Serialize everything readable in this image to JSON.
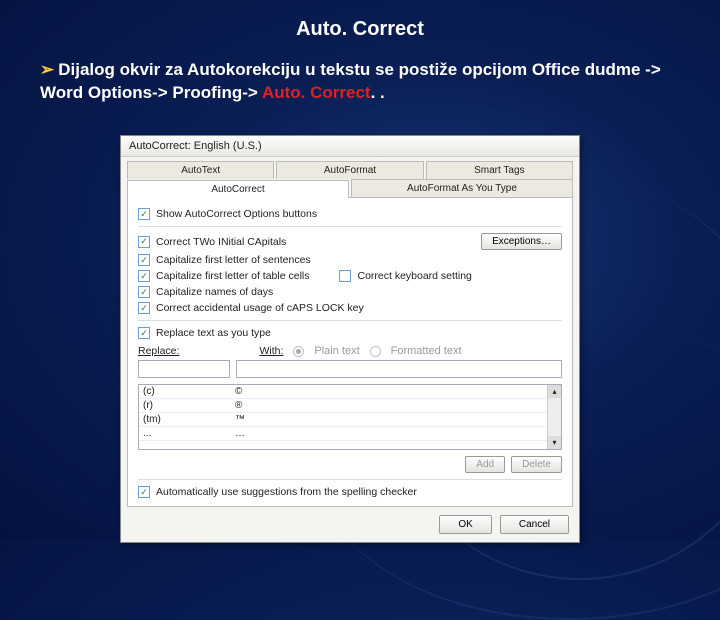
{
  "slide": {
    "title": "Auto. Correct",
    "desc_pre": "Dijalog okvir za Autokorekciju u tekstu se postiže opcijom Office dudme -> Word Options-> Proofing-> ",
    "desc_hl": "Auto. Correct",
    "desc_post": ". ."
  },
  "dialog": {
    "title": "AutoCorrect: English (U.S.)",
    "tabs_top": [
      "AutoText",
      "AutoFormat",
      "Smart Tags"
    ],
    "tabs_bottom": [
      "AutoCorrect",
      "AutoFormat As You Type"
    ],
    "opts": {
      "show_buttons": "Show AutoCorrect Options buttons",
      "two_initial": "Correct TWo INitial CApitals",
      "first_sentence": "Capitalize first letter of sentences",
      "first_cell": "Capitalize first letter of table cells",
      "correct_keyb": "Correct keyboard setting",
      "days": "Capitalize names of days",
      "caps_lock": "Correct accidental usage of cAPS LOCK key",
      "replace": "Replace text as you type"
    },
    "exceptions_btn": "Exceptions…",
    "replace_label": "Replace:",
    "with_label": "With:",
    "radio_plain": "Plain text",
    "radio_formatted": "Formatted text",
    "table_rows": [
      {
        "r": "(c)",
        "w": "©"
      },
      {
        "r": "(r)",
        "w": "®"
      },
      {
        "r": "(tm)",
        "w": "™"
      },
      {
        "r": "...",
        "w": "…"
      }
    ],
    "add_btn": "Add",
    "delete_btn": "Delete",
    "auto_spell": "Automatically use suggestions from the spelling checker",
    "ok": "OK",
    "cancel": "Cancel"
  }
}
